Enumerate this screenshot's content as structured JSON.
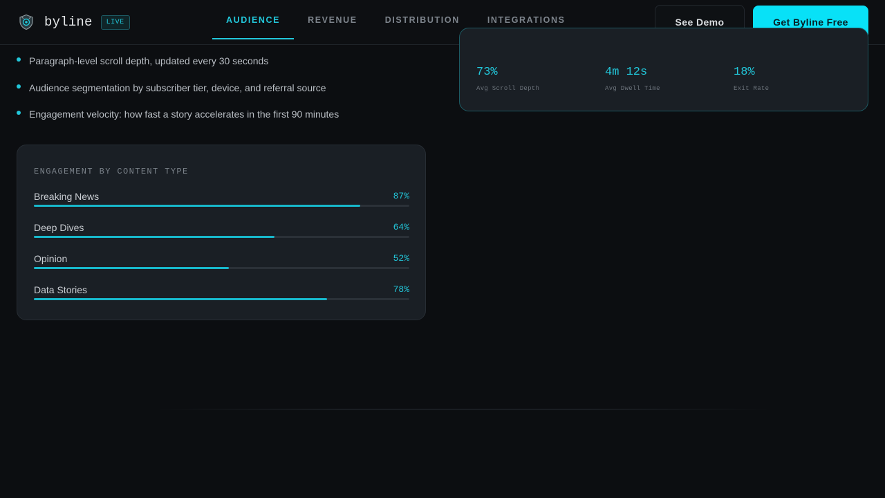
{
  "header": {
    "brand_name": "byline",
    "badge": "LIVE",
    "logo_icon": "shield-eye-icon",
    "nav_tabs": [
      {
        "label": "AUDIENCE",
        "active": true
      },
      {
        "label": "REVENUE",
        "active": false
      },
      {
        "label": "DISTRIBUTION",
        "active": false
      },
      {
        "label": "INTEGRATIONS",
        "active": false
      }
    ],
    "demo_button": "See Demo",
    "cta_button": "Get Byline Free"
  },
  "features": [
    "Paragraph-level scroll depth, updated every 30 seconds",
    "Audience segmentation by subscriber tier, device, and referral source",
    "Engagement velocity: how fast a story accelerates in the first 90 minutes"
  ],
  "engagement": {
    "title": "ENGAGEMENT BY CONTENT TYPE",
    "rows": [
      {
        "label": "Breaking News",
        "pct_label": "87%",
        "value": 87
      },
      {
        "label": "Deep Dives",
        "pct_label": "64%",
        "value": 64
      },
      {
        "label": "Opinion",
        "pct_label": "52%",
        "value": 52
      },
      {
        "label": "Data Stories",
        "pct_label": "78%",
        "value": 78
      }
    ]
  },
  "stats": [
    {
      "value": "73%",
      "label": "Avg Scroll Depth"
    },
    {
      "value": "4m 12s",
      "label": "Avg Dwell Time"
    },
    {
      "value": "18%",
      "label": "Exit Rate"
    }
  ],
  "colors": {
    "accent": "#22c7da",
    "cta": "#08e1f7",
    "background": "#0c0e11",
    "card": "#1a1f25"
  }
}
